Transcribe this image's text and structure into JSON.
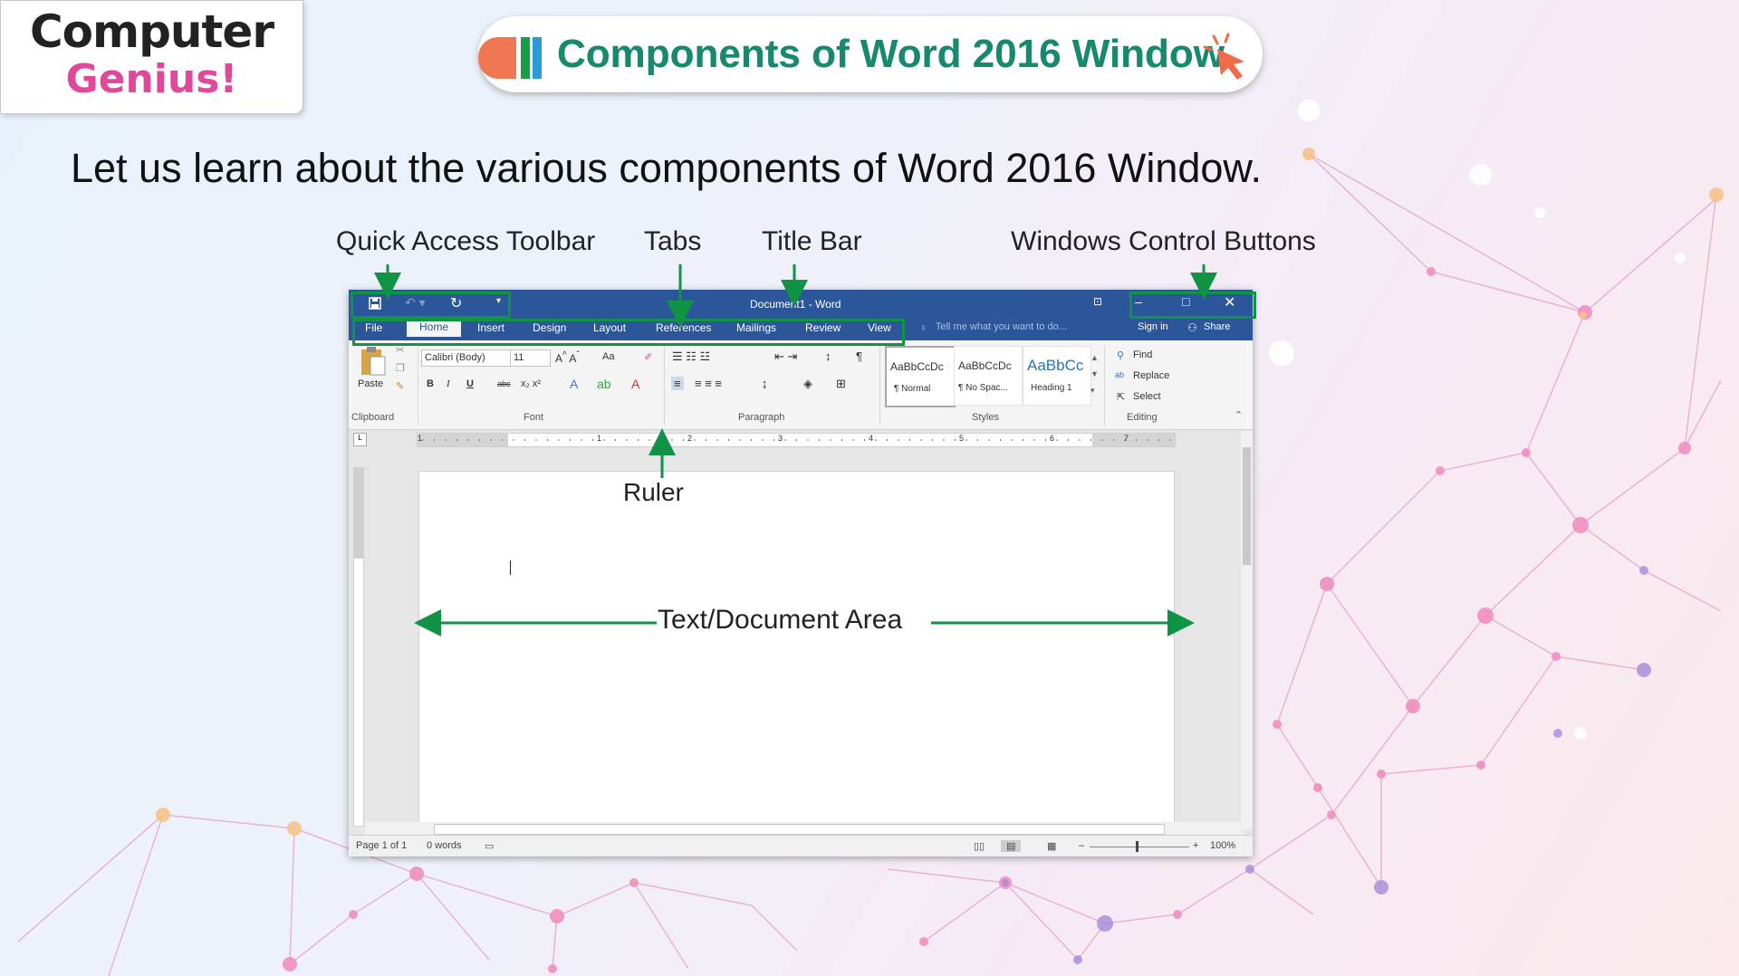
{
  "logo": {
    "line1": "Computer",
    "line2": "Genius!"
  },
  "header": {
    "title": "Components of Word 2016 Window"
  },
  "intro": "Let us learn about the various components of Word 2016 Window.",
  "callouts": {
    "quick_access": "Quick Access Toolbar",
    "tabs": "Tabs",
    "title_bar": "Title Bar",
    "window_controls": "Windows Control Buttons",
    "ruler": "Ruler",
    "doc_area": "Text/Document Area"
  },
  "word": {
    "doc_title": "Document1 - Word",
    "tabs": [
      "File",
      "Home",
      "Insert",
      "Design",
      "Layout",
      "References",
      "Mailings",
      "Review",
      "View"
    ],
    "tell_me": "Tell me what you want to do...",
    "sign_in": "Sign in",
    "share": "Share",
    "paste": "Paste",
    "font_name": "Calibri (Body)",
    "font_size": "11",
    "case_btn": "Aa",
    "groups": {
      "clipboard": "Clipboard",
      "font": "Font",
      "paragraph": "Paragraph",
      "styles": "Styles",
      "editing": "Editing"
    },
    "styles": [
      {
        "preview": "AaBbCcDc",
        "name": "¶ Normal"
      },
      {
        "preview": "AaBbCcDc",
        "name": "¶ No Spac..."
      },
      {
        "preview": "AaBbCc",
        "name": "Heading 1"
      }
    ],
    "editing": {
      "find": "Find",
      "replace": "Replace",
      "select": "Select"
    },
    "ruler_numbers": [
      "1",
      "1",
      "2",
      "3",
      "4",
      "5",
      "6",
      "7"
    ],
    "status": {
      "page": "Page 1 of 1",
      "words": "0 words",
      "zoom": "100%"
    }
  },
  "colors": {
    "accent_green": "#119345",
    "word_blue": "#2b579a",
    "logo_pink": "#e2479b"
  }
}
